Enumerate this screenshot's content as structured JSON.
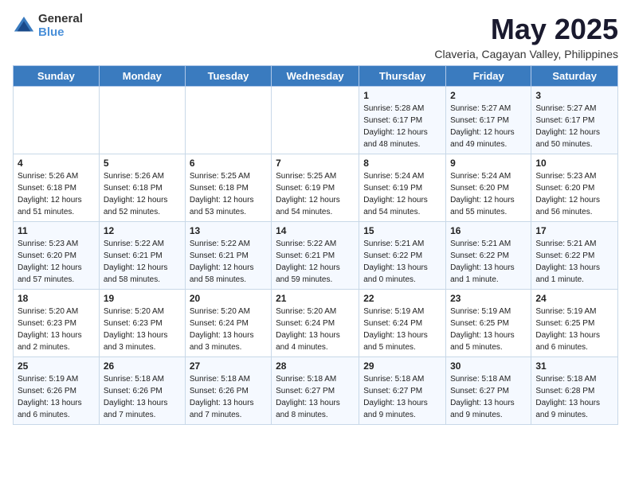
{
  "logo": {
    "general": "General",
    "blue": "Blue"
  },
  "title": "May 2025",
  "subtitle": "Claveria, Cagayan Valley, Philippines",
  "days_of_week": [
    "Sunday",
    "Monday",
    "Tuesday",
    "Wednesday",
    "Thursday",
    "Friday",
    "Saturday"
  ],
  "weeks": [
    [
      {
        "day": "",
        "info": ""
      },
      {
        "day": "",
        "info": ""
      },
      {
        "day": "",
        "info": ""
      },
      {
        "day": "",
        "info": ""
      },
      {
        "day": "1",
        "info": "Sunrise: 5:28 AM\nSunset: 6:17 PM\nDaylight: 12 hours\nand 48 minutes."
      },
      {
        "day": "2",
        "info": "Sunrise: 5:27 AM\nSunset: 6:17 PM\nDaylight: 12 hours\nand 49 minutes."
      },
      {
        "day": "3",
        "info": "Sunrise: 5:27 AM\nSunset: 6:17 PM\nDaylight: 12 hours\nand 50 minutes."
      }
    ],
    [
      {
        "day": "4",
        "info": "Sunrise: 5:26 AM\nSunset: 6:18 PM\nDaylight: 12 hours\nand 51 minutes."
      },
      {
        "day": "5",
        "info": "Sunrise: 5:26 AM\nSunset: 6:18 PM\nDaylight: 12 hours\nand 52 minutes."
      },
      {
        "day": "6",
        "info": "Sunrise: 5:25 AM\nSunset: 6:18 PM\nDaylight: 12 hours\nand 53 minutes."
      },
      {
        "day": "7",
        "info": "Sunrise: 5:25 AM\nSunset: 6:19 PM\nDaylight: 12 hours\nand 54 minutes."
      },
      {
        "day": "8",
        "info": "Sunrise: 5:24 AM\nSunset: 6:19 PM\nDaylight: 12 hours\nand 54 minutes."
      },
      {
        "day": "9",
        "info": "Sunrise: 5:24 AM\nSunset: 6:20 PM\nDaylight: 12 hours\nand 55 minutes."
      },
      {
        "day": "10",
        "info": "Sunrise: 5:23 AM\nSunset: 6:20 PM\nDaylight: 12 hours\nand 56 minutes."
      }
    ],
    [
      {
        "day": "11",
        "info": "Sunrise: 5:23 AM\nSunset: 6:20 PM\nDaylight: 12 hours\nand 57 minutes."
      },
      {
        "day": "12",
        "info": "Sunrise: 5:22 AM\nSunset: 6:21 PM\nDaylight: 12 hours\nand 58 minutes."
      },
      {
        "day": "13",
        "info": "Sunrise: 5:22 AM\nSunset: 6:21 PM\nDaylight: 12 hours\nand 58 minutes."
      },
      {
        "day": "14",
        "info": "Sunrise: 5:22 AM\nSunset: 6:21 PM\nDaylight: 12 hours\nand 59 minutes."
      },
      {
        "day": "15",
        "info": "Sunrise: 5:21 AM\nSunset: 6:22 PM\nDaylight: 13 hours\nand 0 minutes."
      },
      {
        "day": "16",
        "info": "Sunrise: 5:21 AM\nSunset: 6:22 PM\nDaylight: 13 hours\nand 1 minute."
      },
      {
        "day": "17",
        "info": "Sunrise: 5:21 AM\nSunset: 6:22 PM\nDaylight: 13 hours\nand 1 minute."
      }
    ],
    [
      {
        "day": "18",
        "info": "Sunrise: 5:20 AM\nSunset: 6:23 PM\nDaylight: 13 hours\nand 2 minutes."
      },
      {
        "day": "19",
        "info": "Sunrise: 5:20 AM\nSunset: 6:23 PM\nDaylight: 13 hours\nand 3 minutes."
      },
      {
        "day": "20",
        "info": "Sunrise: 5:20 AM\nSunset: 6:24 PM\nDaylight: 13 hours\nand 3 minutes."
      },
      {
        "day": "21",
        "info": "Sunrise: 5:20 AM\nSunset: 6:24 PM\nDaylight: 13 hours\nand 4 minutes."
      },
      {
        "day": "22",
        "info": "Sunrise: 5:19 AM\nSunset: 6:24 PM\nDaylight: 13 hours\nand 5 minutes."
      },
      {
        "day": "23",
        "info": "Sunrise: 5:19 AM\nSunset: 6:25 PM\nDaylight: 13 hours\nand 5 minutes."
      },
      {
        "day": "24",
        "info": "Sunrise: 5:19 AM\nSunset: 6:25 PM\nDaylight: 13 hours\nand 6 minutes."
      }
    ],
    [
      {
        "day": "25",
        "info": "Sunrise: 5:19 AM\nSunset: 6:26 PM\nDaylight: 13 hours\nand 6 minutes."
      },
      {
        "day": "26",
        "info": "Sunrise: 5:18 AM\nSunset: 6:26 PM\nDaylight: 13 hours\nand 7 minutes."
      },
      {
        "day": "27",
        "info": "Sunrise: 5:18 AM\nSunset: 6:26 PM\nDaylight: 13 hours\nand 7 minutes."
      },
      {
        "day": "28",
        "info": "Sunrise: 5:18 AM\nSunset: 6:27 PM\nDaylight: 13 hours\nand 8 minutes."
      },
      {
        "day": "29",
        "info": "Sunrise: 5:18 AM\nSunset: 6:27 PM\nDaylight: 13 hours\nand 9 minutes."
      },
      {
        "day": "30",
        "info": "Sunrise: 5:18 AM\nSunset: 6:27 PM\nDaylight: 13 hours\nand 9 minutes."
      },
      {
        "day": "31",
        "info": "Sunrise: 5:18 AM\nSunset: 6:28 PM\nDaylight: 13 hours\nand 9 minutes."
      }
    ]
  ]
}
